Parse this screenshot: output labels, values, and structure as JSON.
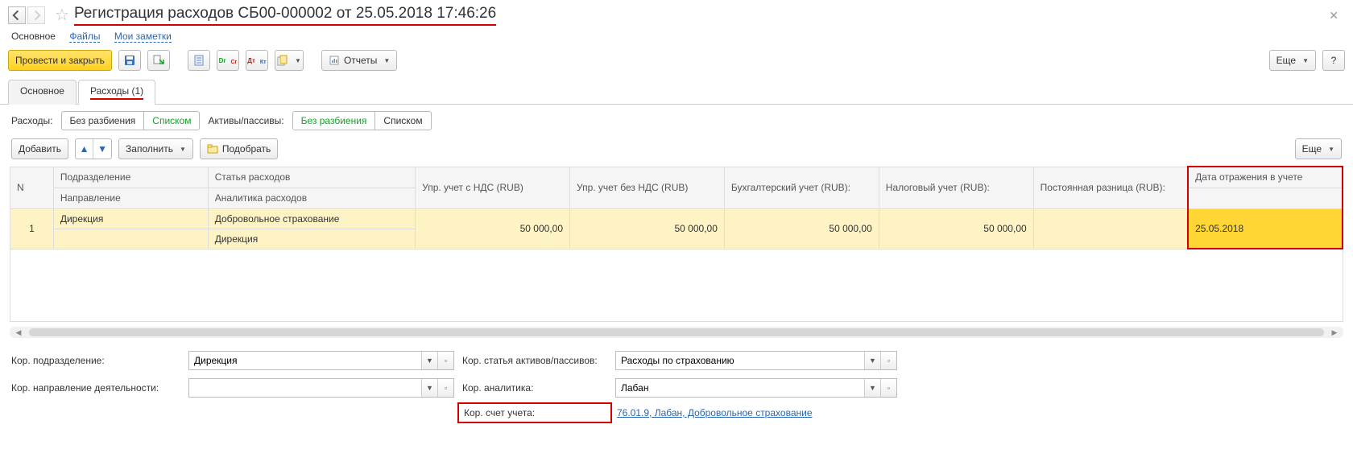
{
  "header": {
    "title": "Регистрация расходов СБ00-000002 от 25.05.2018 17:46:26"
  },
  "subnav": {
    "main": "Основное",
    "files": "Файлы",
    "notes": "Мои заметки"
  },
  "toolbar": {
    "post_close": "Провести и закрыть",
    "reports": "Отчеты",
    "more": "Еще"
  },
  "tabs": {
    "main": "Основное",
    "expenses": "Расходы (1)"
  },
  "segments": {
    "expenses_label": "Расходы:",
    "assets_label": "Активы/пассивы:",
    "no_split": "Без разбиения",
    "list": "Списком"
  },
  "actions": {
    "add": "Добавить",
    "fill": "Заполнить",
    "pick": "Подобрать",
    "more": "Еще"
  },
  "table": {
    "headers": {
      "n": "N",
      "dept": "Подразделение",
      "direction": "Направление",
      "article": "Статья расходов",
      "analytics": "Аналитика расходов",
      "mgmt_vat": "Упр. учет с НДС (RUB)",
      "mgmt_novat": "Упр. учет без НДС (RUB)",
      "acct": "Бухгалтерский учет (RUB):",
      "tax": "Налоговый учет (RUB):",
      "perm_diff": "Постоянная разница (RUB):",
      "date": "Дата отражения в учете"
    },
    "rows": [
      {
        "n": "1",
        "dept": "Дирекция",
        "direction": "",
        "article": "Добровольное страхование",
        "analytics": "Дирекция",
        "mgmt_vat": "50 000,00",
        "mgmt_novat": "50 000,00",
        "acct": "50 000,00",
        "tax": "50 000,00",
        "perm_diff": "",
        "date": "25.05.2018"
      }
    ]
  },
  "form": {
    "corr_dept_label": "Кор. подразделение:",
    "corr_dept_value": "Дирекция",
    "corr_article_label": "Кор. статья активов/пассивов:",
    "corr_article_value": "Расходы по страхованию",
    "corr_dir_label": "Кор. направление деятельности:",
    "corr_dir_value": "",
    "corr_analytics_label": "Кор. аналитика:",
    "corr_analytics_value": "Лабан",
    "corr_account_label": "Кор. счет учета:",
    "corr_account_value": "76.01.9, Лабан, Добровольное страхование"
  }
}
